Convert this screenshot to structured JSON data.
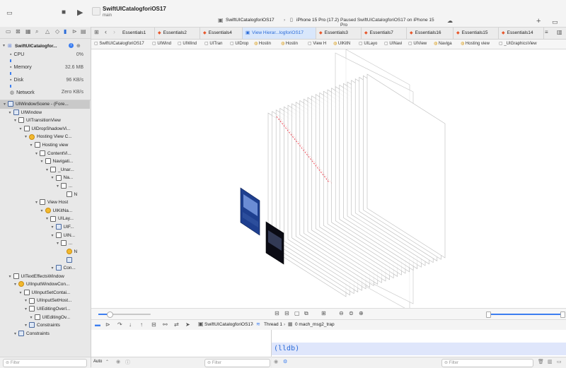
{
  "window": {
    "project_title": "SwiftUICatalogforiOS17",
    "branch": "main",
    "scheme": "SwiftUICatalogforiOS17",
    "device": "iPhone 15 Pro (17.2)",
    "status": "Paused SwiftUICatalogforiOS17 on iPhone 15 Pro"
  },
  "navigator": {
    "process_name": "SwiftUICatalogfor...",
    "gauges": [
      {
        "label": "CPU",
        "value": "0%"
      },
      {
        "label": "Memory",
        "value": "32.6 MB"
      },
      {
        "label": "Disk",
        "value": "96 KB/s"
      },
      {
        "label": "Network",
        "value": "Zero KB/s"
      }
    ],
    "tree": [
      {
        "label": "UIWindowScene - (Fore...",
        "indent": 0,
        "icon": "box-blue",
        "selected": true
      },
      {
        "label": "UIWindow",
        "indent": 1,
        "icon": "box-blue"
      },
      {
        "label": "UITransitionView",
        "indent": 2,
        "icon": "box"
      },
      {
        "label": "UIDropShadowVi...",
        "indent": 3,
        "icon": "box"
      },
      {
        "label": "Hosting View C...",
        "indent": 4,
        "icon": "circle"
      },
      {
        "label": "Hosting view",
        "indent": 5,
        "icon": "box"
      },
      {
        "label": "ContentVi...",
        "indent": 6,
        "icon": "box"
      },
      {
        "label": "Navigati...",
        "indent": 7,
        "icon": "box"
      },
      {
        "label": "_Unar...",
        "indent": 8,
        "icon": "box"
      },
      {
        "label": "Na...",
        "indent": 9,
        "icon": "box"
      },
      {
        "label": "...",
        "indent": 10,
        "icon": "box"
      },
      {
        "label": "N",
        "indent": 11,
        "icon": "box"
      },
      {
        "label": "View Host",
        "indent": 6,
        "icon": "box"
      },
      {
        "label": "UIKitNa...",
        "indent": 7,
        "icon": "circle"
      },
      {
        "label": "UILay...",
        "indent": 8,
        "icon": "box"
      },
      {
        "label": "UIF...",
        "indent": 9,
        "icon": "box-blue"
      },
      {
        "label": "UIN...",
        "indent": 9,
        "icon": "box"
      },
      {
        "label": "...",
        "indent": 10,
        "icon": "box"
      },
      {
        "label": "N",
        "indent": 11,
        "icon": "circle"
      },
      {
        "label": "",
        "indent": 11,
        "icon": "box-blue"
      },
      {
        "label": "Con...",
        "indent": 9,
        "icon": "box-blue"
      },
      {
        "label": "UITextEffectsWindow",
        "indent": 1,
        "icon": "box"
      },
      {
        "label": "UIInputWindowCon...",
        "indent": 2,
        "icon": "circle"
      },
      {
        "label": "UIInputSetContai...",
        "indent": 3,
        "icon": "box"
      },
      {
        "label": "UIInputSetHost...",
        "indent": 4,
        "icon": "box"
      },
      {
        "label": "UIEditingOverl...",
        "indent": 4,
        "icon": "box"
      },
      {
        "label": "UIEditingOv...",
        "indent": 5,
        "icon": "box"
      },
      {
        "label": "Constraints",
        "indent": 4,
        "icon": "box-blue"
      },
      {
        "label": "Constraints",
        "indent": 2,
        "icon": "box-blue"
      }
    ],
    "filter_placeholder": "Filter"
  },
  "tabs": [
    {
      "label": "Essentials1",
      "swift": false
    },
    {
      "label": "Essentials2",
      "swift": true
    },
    {
      "label": "Essentials4",
      "swift": true
    },
    {
      "label": "View Hierar...logforiOS17",
      "swift": false,
      "active": true
    },
    {
      "label": "Essentials3",
      "swift": true
    },
    {
      "label": "Essentials7",
      "swift": true
    },
    {
      "label": "Essentials16",
      "swift": true
    },
    {
      "label": "Essentials15",
      "swift": true
    },
    {
      "label": "Essentials14",
      "swift": true
    }
  ],
  "jump_bar": [
    "SwiftUICatalogforiOS17",
    "UIWind",
    "UIWind",
    "UITran",
    "UIDrop",
    "Hostin",
    "Hostin",
    "View H",
    "UIKitN",
    "UILayo",
    "UINavi",
    "UIView",
    "Naviga",
    "Hosting view",
    "_UIGraphicsView"
  ],
  "debug": {
    "scheme": "SwiftUICatalogforiOS17",
    "thread": "Thread 1",
    "frame": "0 mach_msg2_trap",
    "lldb_prompt": "(lldb)",
    "auto_label": "Auto",
    "filter_placeholder": "Filter"
  },
  "colors": {
    "accent": "#2a6bd8",
    "swift": "#e8572b",
    "selection": "#c9c9c9"
  }
}
